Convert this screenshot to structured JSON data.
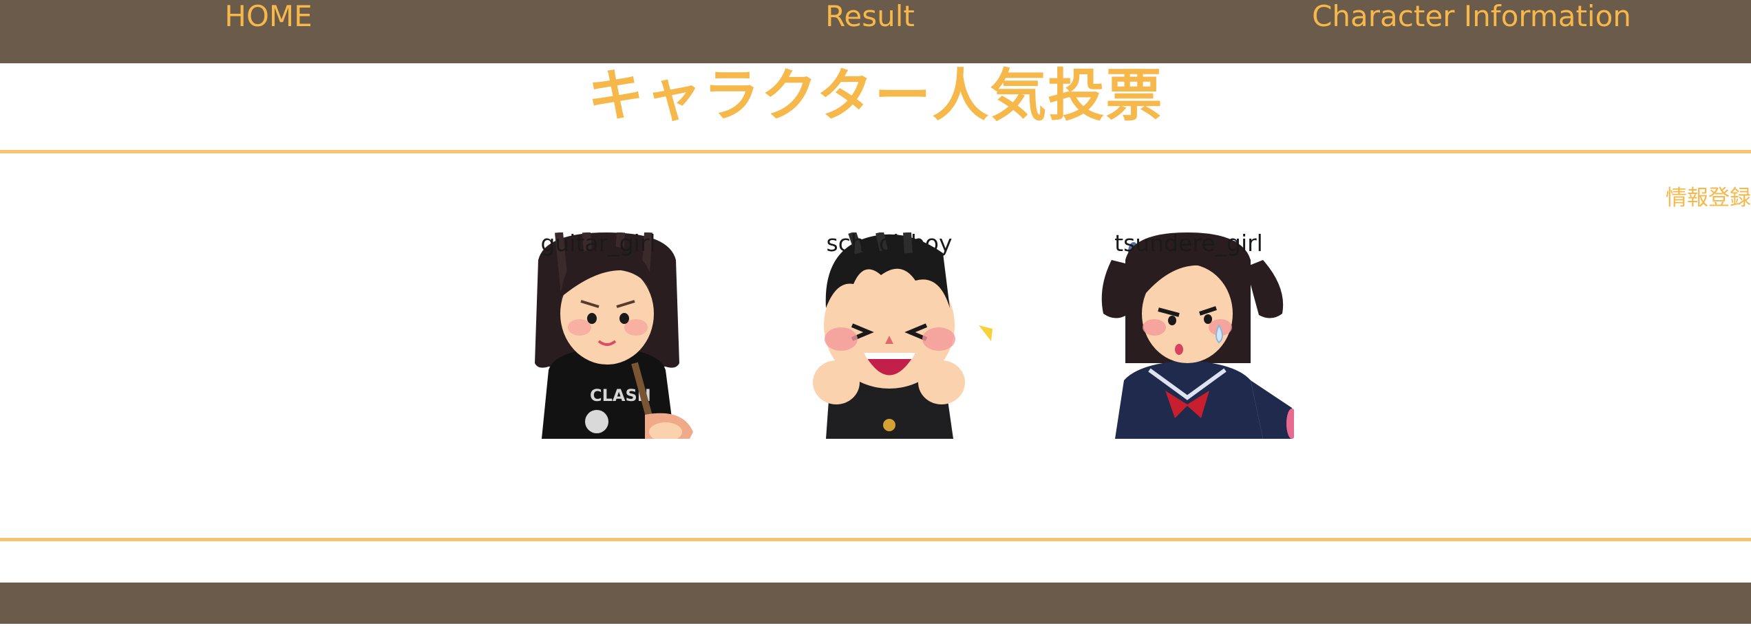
{
  "nav": {
    "links": [
      {
        "label": "HOME"
      },
      {
        "label": "Result"
      },
      {
        "label": "Character Information"
      }
    ]
  },
  "header": {
    "title": "キャラクター人気投票"
  },
  "actions": {
    "register_label": "情報登録"
  },
  "characters": [
    {
      "name": "guitar_girl",
      "illustration": "guitar-girl-illustration"
    },
    {
      "name": "school_boy",
      "illustration": "school-boy-illustration"
    },
    {
      "name": "tsundere_girl",
      "illustration": "tsundere-girl-illustration"
    }
  ],
  "colors": {
    "nav_bg": "#6b5b4a",
    "accent": "#f7b84b",
    "rule": "#f8c270",
    "text": "#1a1a1a"
  }
}
